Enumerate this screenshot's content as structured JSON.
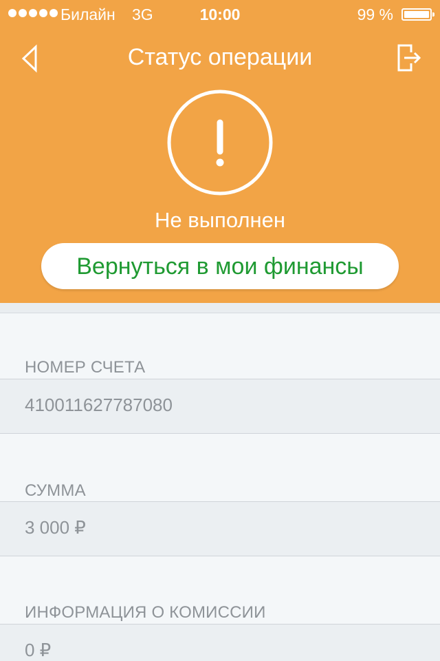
{
  "status_bar": {
    "carrier": "Билайн",
    "network": "3G",
    "time": "10:00",
    "battery": "99 %",
    "signal_icon": "signal-dots-icon",
    "battery_icon": "battery-icon"
  },
  "nav": {
    "title": "Статус операции",
    "back_icon": "back-arrow-icon",
    "logout_icon": "logout-icon"
  },
  "result": {
    "icon": "exclamation-circle-icon",
    "status_text": "Не выполнен",
    "return_button_label": "Вернуться в мои финансы"
  },
  "details": {
    "account_label": "НОМЕР СЧЕТА",
    "account_value": "410011627787080",
    "amount_label": "СУММА",
    "amount_value": "3 000 ₽",
    "fee_label": "ИНФОРМАЦИЯ О КОМИССИИ",
    "fee_value": "0 ₽"
  },
  "colors": {
    "header_background": "#f2a446",
    "button_text": "#1f9a32",
    "content_background": "#f4f7f9"
  }
}
